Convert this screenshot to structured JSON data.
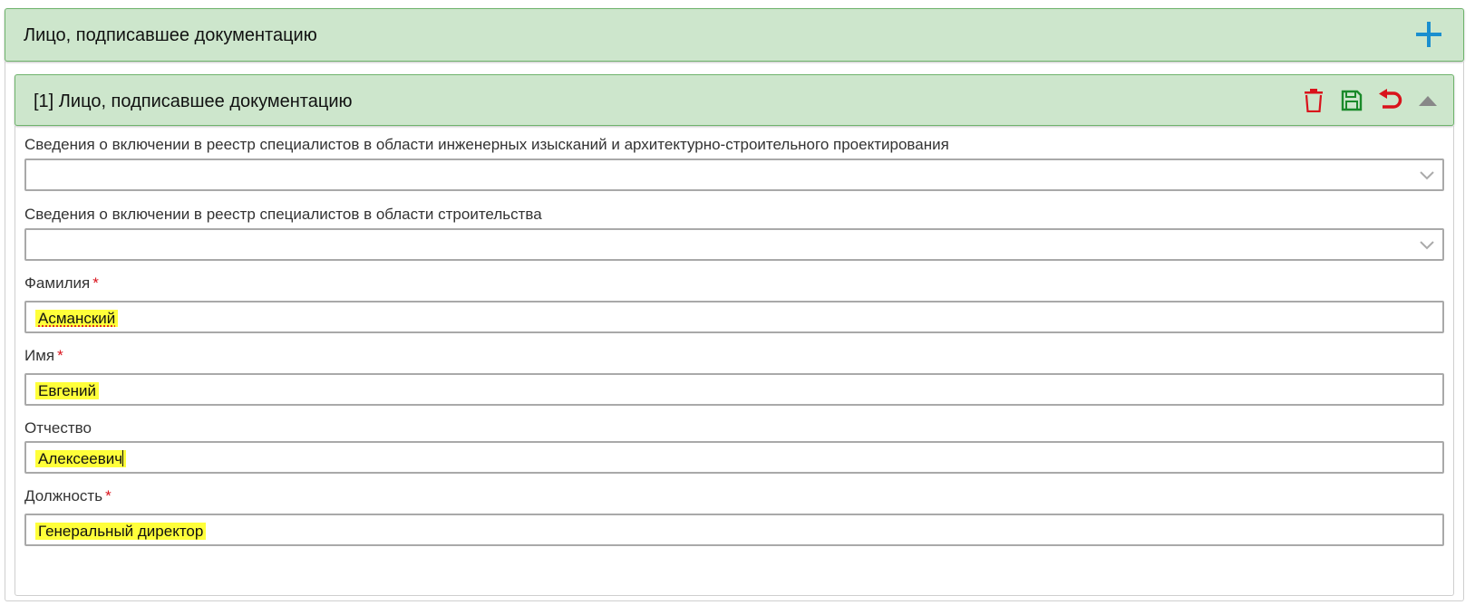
{
  "outer": {
    "title": "Лицо, подписавшее документацию",
    "add_icon": "plus-icon"
  },
  "inner": {
    "title": "[1] Лицо, подписавшее документацию",
    "actions": [
      "trash-icon",
      "save-icon",
      "undo-icon",
      "collapse-icon"
    ]
  },
  "fields": {
    "registry_design": {
      "label": "Сведения о включении в реестр специалистов в области инженерных изысканий и архитектурно-строительного проектирования",
      "value": ""
    },
    "registry_construction": {
      "label": "Сведения о включении в реестр специалистов в области строительства",
      "value": ""
    },
    "last_name": {
      "label": "Фамилия",
      "required": "*",
      "value": "Асманский"
    },
    "first_name": {
      "label": "Имя",
      "required": "*",
      "value": "Евгений"
    },
    "patronymic": {
      "label": "Отчество",
      "value": "Алексеевич"
    },
    "position": {
      "label": "Должность",
      "required": "*",
      "value": "Генеральный директор"
    }
  },
  "colors": {
    "header_bg": "#cde6cc",
    "header_border": "#6fb46c",
    "plus": "#1a8fcf",
    "trash": "#d9131c",
    "save": "#1a8a2a",
    "undo": "#d9131c",
    "collapse": "#888888",
    "highlight": "#ffff3a",
    "required": "#d9131c"
  }
}
